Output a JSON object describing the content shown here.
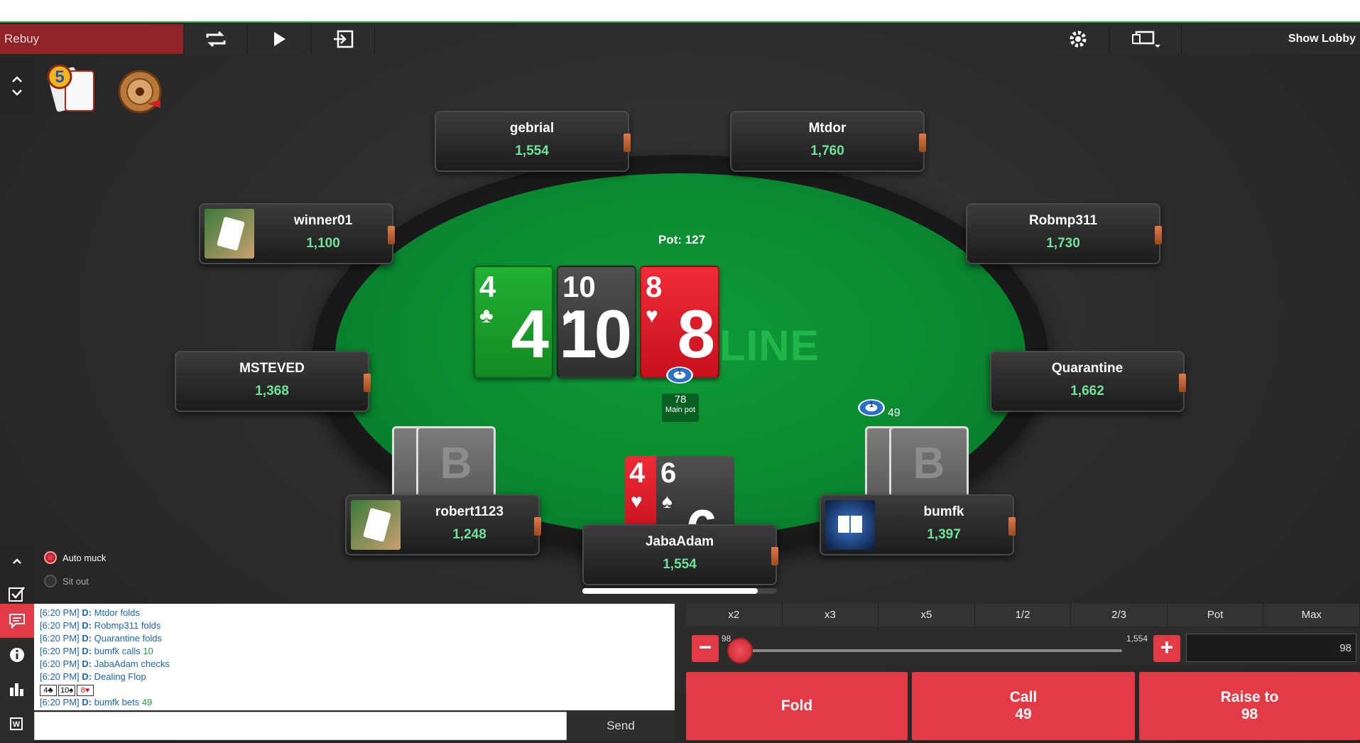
{
  "toolbar": {
    "rebuy_label": "Rebuy",
    "show_lobby_label": "Show Lobby"
  },
  "table": {
    "pot_text": "Pot: 127",
    "logo_text": "LINE",
    "main_pot_amount": "78",
    "main_pot_label": "Main pot",
    "bumfk_bet": "49",
    "dealer_label": "D",
    "chip_label": "1"
  },
  "community_cards": [
    {
      "rank": "4",
      "suit": "♣",
      "color": "#1a9a2a"
    },
    {
      "rank": "10",
      "suit": "♠",
      "color": "#3a3a3a"
    },
    {
      "rank": "8",
      "suit": "♥",
      "color": "#d81e2a"
    }
  ],
  "hero_cards": [
    {
      "rank": "4",
      "suit": "♥"
    },
    {
      "rank": "6",
      "suit": "♠"
    }
  ],
  "card_back_letter": "B",
  "players": {
    "gebrial": {
      "name": "gebrial",
      "stack": "1,554"
    },
    "mtdor": {
      "name": "Mtdor",
      "stack": "1,760"
    },
    "winner01": {
      "name": "winner01",
      "stack": "1,100"
    },
    "robmp311": {
      "name": "Robmp311",
      "stack": "1,730"
    },
    "msteved": {
      "name": "MSTEVED",
      "stack": "1,368"
    },
    "quarantine": {
      "name": "Quarantine",
      "stack": "1,662"
    },
    "robert1123": {
      "name": "robert1123",
      "stack": "1,248"
    },
    "bumfk": {
      "name": "bumfk",
      "stack": "1,397"
    },
    "jabaadam": {
      "name": "JabaAdam",
      "stack": "1,554"
    }
  },
  "options": {
    "auto_muck": "Auto muck",
    "sit_out": "Sit out"
  },
  "chat": {
    "lines": [
      {
        "time": "[6:20 PM]",
        "text": "Mtdor  folds"
      },
      {
        "time": "[6:20 PM]",
        "text": "Robmp311  folds"
      },
      {
        "time": "[6:20 PM]",
        "text": "Quarantine  folds"
      },
      {
        "time": "[6:20 PM]",
        "text": "bumfk  calls",
        "amount": "10"
      },
      {
        "time": "[6:20 PM]",
        "text": "JabaAdam  checks"
      },
      {
        "time": "[6:20 PM]",
        "text": "Dealing Flop"
      }
    ],
    "flop_cards": [
      {
        "rank": "4",
        "suit": "♣"
      },
      {
        "rank": "10",
        "suit": "♠"
      },
      {
        "rank": "8",
        "suit": "♥"
      }
    ],
    "last_line": {
      "time": "[6:20 PM]",
      "text": "bumfk  bets",
      "amount": "49"
    },
    "send_label": "Send"
  },
  "bet": {
    "presets": [
      "x2",
      "x3",
      "x5",
      "1/2",
      "2/3",
      "Pot",
      "Max"
    ],
    "min": "98",
    "max": "1,554",
    "value": "98"
  },
  "actions": {
    "fold": "Fold",
    "call_label": "Call",
    "call_amount": "49",
    "raise_label": "Raise to",
    "raise_amount": "98"
  },
  "colors": {
    "accent": "#e23b45",
    "felt": "#0a8a30",
    "stack": "#6fe39a"
  }
}
